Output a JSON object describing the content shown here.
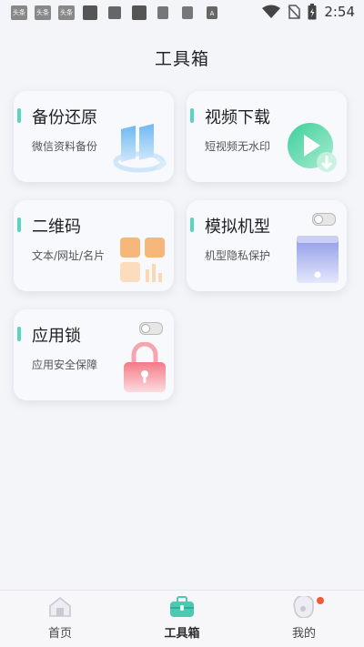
{
  "status_bar": {
    "time": "2:54",
    "notification_icons": [
      "头条",
      "头条",
      "头条",
      "app-icon",
      "image-icon",
      "app-icon",
      "book-icon",
      "book-icon",
      "font-icon"
    ],
    "right_icons": [
      "wifi-icon",
      "no-sim-icon",
      "battery-charging-icon"
    ]
  },
  "page": {
    "title": "工具箱"
  },
  "tools": [
    {
      "title": "备份还原",
      "subtitle": "微信资料备份",
      "icon": "backup-icon"
    },
    {
      "title": "视频下载",
      "subtitle": "短视频无水印",
      "icon": "video-download-icon"
    },
    {
      "title": "二维码",
      "subtitle": "文本/网址/名片",
      "icon": "qr-code-icon"
    },
    {
      "title": "模拟机型",
      "subtitle": "机型隐私保护",
      "icon": "phone-model-icon",
      "toggle": false
    },
    {
      "title": "应用锁",
      "subtitle": "应用安全保障",
      "icon": "lock-icon",
      "toggle": false
    }
  ],
  "nav": {
    "items": [
      {
        "label": "首页",
        "icon": "home-icon"
      },
      {
        "label": "工具箱",
        "icon": "toolbox-icon",
        "active": true
      },
      {
        "label": "我的",
        "icon": "profile-icon",
        "badge": true
      }
    ]
  },
  "colors": {
    "accent": "#5ad3bf",
    "badge": "#f05a3a",
    "background": "#f4f5f9"
  }
}
